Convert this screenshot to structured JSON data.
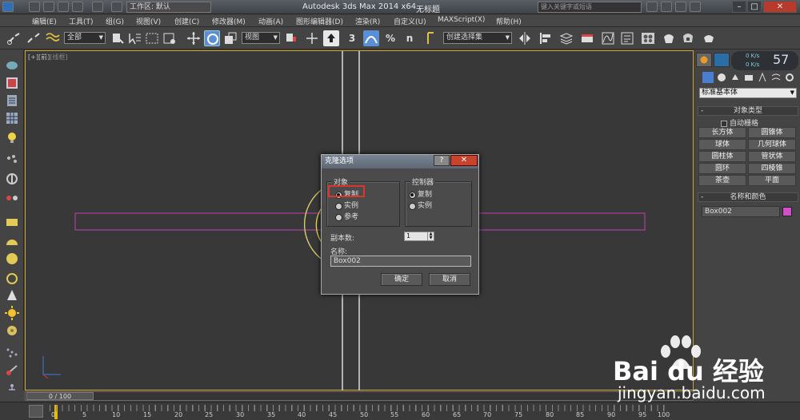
{
  "titlebar": {
    "workspace": "工作区: 默认",
    "app_title": "Autodesk 3ds Max  2014 x64",
    "doc_title": "无标题",
    "search_placeholder": "键入关键字或短语"
  },
  "menu": [
    "编辑(E)",
    "工具(T)",
    "组(G)",
    "视图(V)",
    "创建(C)",
    "修改器(M)",
    "动画(A)",
    "图形编辑器(D)",
    "渲染(R)",
    "自定义(U)",
    "MAXScript(X)",
    "帮助(H)"
  ],
  "toolbar": {
    "selection_filter": "全部",
    "ref_coord": "视图",
    "named_selection": "创建选择集",
    "snap_label": "3",
    "percent_snap_label": "%",
    "spinner_snap_label": "n"
  },
  "viewport": {
    "label_bracket": "[+]",
    "label_view": "[前]",
    "label_shade": "[线框]"
  },
  "command_panel": {
    "hud_percent": "57",
    "hud_lines": [
      "0 K/s",
      "0 K/s"
    ],
    "category_dropdown": "标准基本体",
    "object_type_header": "对象类型",
    "autogrid_label": "自动栅格",
    "object_buttons": [
      "长方体",
      "圆锥体",
      "球体",
      "几何球体",
      "圆柱体",
      "管状体",
      "圆环",
      "四棱锥",
      "茶壶",
      "平面"
    ],
    "name_color_header": "名称和颜色",
    "object_name": "Box002",
    "object_color": "#d050c8"
  },
  "timeline": {
    "slider_label": "0 / 100",
    "ticks": [
      "0",
      "5",
      "10",
      "15",
      "20",
      "25",
      "30",
      "35",
      "40",
      "45",
      "50",
      "55",
      "60",
      "65",
      "70",
      "75",
      "80",
      "85",
      "90",
      "95",
      "100"
    ]
  },
  "dialog": {
    "title": "克隆选项",
    "help_label": "?",
    "close_label": "✕",
    "object_group": "对象",
    "object_options": [
      "复制",
      "实例",
      "参考"
    ],
    "object_selected": "复制",
    "controller_group": "控制器",
    "controller_options": [
      "复制",
      "实例"
    ],
    "copies_label": "副本数:",
    "copies_value": "1",
    "name_label": "名称:",
    "name_value": "Box002",
    "ok_label": "确定",
    "cancel_label": "取消"
  },
  "watermark": {
    "brand": "Bai du 经验",
    "url": "jingyan.baidu.com"
  }
}
